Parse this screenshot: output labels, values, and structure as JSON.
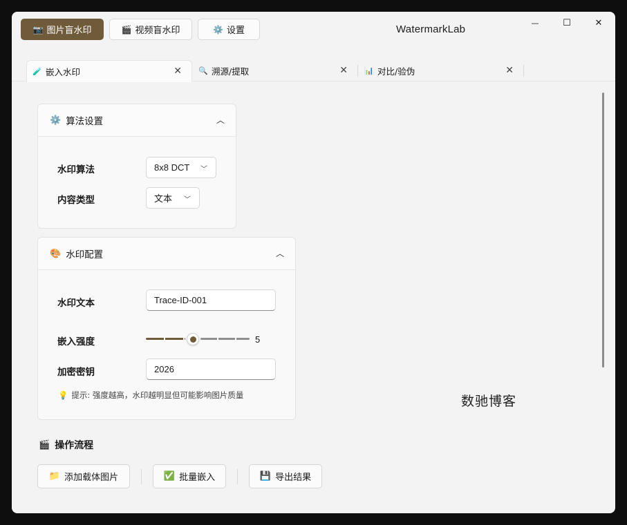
{
  "app": {
    "title": "WatermarkLab"
  },
  "nav": {
    "image": {
      "icon": "📷",
      "label": "图片盲水印"
    },
    "video": {
      "icon": "🎬",
      "label": "视频盲水印"
    },
    "settings": {
      "icon": "⚙️",
      "label": "设置"
    }
  },
  "window_controls": {
    "minimize": "—",
    "maximize": "☐",
    "close": "✕"
  },
  "tabs": [
    {
      "icon": "🧪",
      "label": "嵌入水印",
      "close": "✕"
    },
    {
      "icon": "🔍",
      "label": "溯源/提取",
      "close": "✕"
    },
    {
      "icon": "📊",
      "label": "对比/验伪",
      "close": "✕"
    }
  ],
  "algo_card": {
    "icon": "⚙️",
    "title": "算法设置",
    "chevron": "︿",
    "algorithm": {
      "label": "水印算法",
      "value": "8x8 DCT"
    },
    "content_type": {
      "label": "内容类型",
      "value": "文本"
    }
  },
  "config_card": {
    "icon": "🎨",
    "title": "水印配置",
    "chevron": "︿",
    "text": {
      "label": "水印文本",
      "value": "Trace-ID-001"
    },
    "strength": {
      "label": "嵌入强度",
      "value": "5",
      "min": 1,
      "max": 10
    },
    "key": {
      "label": "加密密钥",
      "value": "2026"
    },
    "hint": {
      "icon": "💡",
      "text": "提示: 强度越高，水印越明显但可能影响图片质量"
    }
  },
  "workflow": {
    "icon": "🎬",
    "title": "操作流程",
    "buttons": {
      "add": {
        "icon": "📁",
        "label": "添加载体图片"
      },
      "batch": {
        "icon": "✅",
        "label": "批量嵌入"
      },
      "export": {
        "icon": "💾",
        "label": "导出结果"
      }
    }
  },
  "preview": {
    "watermark": "数驰博客"
  },
  "colors": {
    "accent": "#6f5a3a",
    "track": "#8f8f8f"
  }
}
